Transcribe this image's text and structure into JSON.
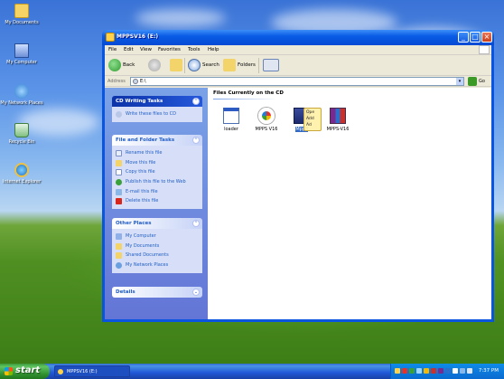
{
  "desktop": {
    "icons": [
      {
        "label": "My Documents",
        "icon": "folder-documents-icon"
      },
      {
        "label": "My Computer",
        "icon": "computer-icon"
      },
      {
        "label": "My Network Places",
        "icon": "network-places-icon"
      },
      {
        "label": "Recycle Bin",
        "icon": "recycle-bin-icon"
      },
      {
        "label": "Internet Explorer",
        "icon": "internet-explorer-icon"
      }
    ]
  },
  "window": {
    "title": "MPPSV16 (E:)",
    "menu": [
      "File",
      "Edit",
      "View",
      "Favorites",
      "Tools",
      "Help"
    ],
    "toolbar": {
      "back": "Back",
      "search": "Search",
      "folders": "Folders"
    },
    "address": {
      "label": "Address",
      "value": "E:\\",
      "go": "Go"
    }
  },
  "taskpane": {
    "cd_writing": {
      "title": "CD Writing Tasks",
      "items": [
        "Write these files to CD"
      ]
    },
    "file_folder": {
      "title": "File and Folder Tasks",
      "items": [
        "Rename this file",
        "Move this file",
        "Copy this file",
        "Publish this file to the Web",
        "E-mail this file",
        "Delete this file"
      ]
    },
    "other_places": {
      "title": "Other Places",
      "items": [
        "My Computer",
        "My Documents",
        "Shared Documents",
        "My Network Places"
      ]
    },
    "details": {
      "title": "Details"
    }
  },
  "content": {
    "heading": "Files Currently on the CD",
    "files": [
      {
        "name": "loader",
        "selected": false
      },
      {
        "name": "MPPS V16",
        "selected": false
      },
      {
        "name": "Mpps",
        "selected": true
      },
      {
        "name": "MPPS-V16",
        "selected": false
      }
    ],
    "tooltip_lines": [
      "Ope",
      "Add",
      "Ad"
    ]
  },
  "taskbar": {
    "start": "start",
    "task_button": "MPPSV16 (E:)",
    "clock": "7:37 PM"
  }
}
